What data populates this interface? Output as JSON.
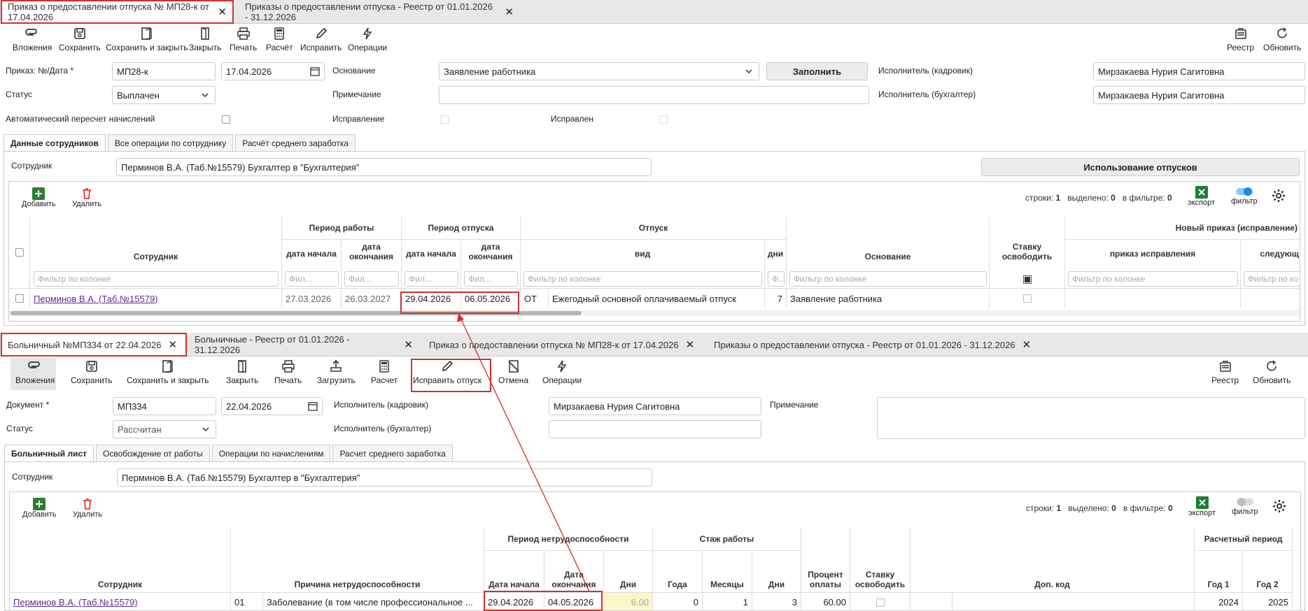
{
  "top": {
    "tabs": [
      {
        "label": "Приказ о предоставлении отпуска № МП28-к от 17.04.2026"
      },
      {
        "label": "Приказы о предоставлении отпуска - Реестр от 01.01.2026 - 31.12.2026"
      }
    ],
    "toolbar": {
      "attachments": "Вложения",
      "save": "Сохранить",
      "save_close": "Сохранить и закрыть",
      "close": "Закрыть",
      "print": "Печать",
      "calc": "Расчёт",
      "fix": "Исправить",
      "operations": "Операции",
      "registry": "Реестр",
      "refresh": "Обновить"
    },
    "form": {
      "order_label": "Приказ: №/Дата *",
      "order_no": "МП28-к",
      "order_date": "17.04.2026",
      "basis_label": "Основание",
      "basis_value": "Заявление работника",
      "fill_button": "Заполнить",
      "executor_hr_label": "Исполнитель (кадровик)",
      "executor_hr": "Мирзакаева Нурия Сагитовна",
      "status_label": "Статус",
      "status_value": "Выплачен",
      "note_label": "Примечание",
      "note_value": "",
      "executor_acc_label": "Исполнитель (бухгалтер)",
      "executor_acc": "Мирзакаева Нурия Сагитовна",
      "auto_recalc_label": "Автоматический пересчет начислений",
      "fix_label": "Исправление",
      "fixed_label": "Исправлен"
    },
    "subtabs": [
      "Данные сотрудников",
      "Все операции по сотруднику",
      "Расчёт среднего заработка"
    ],
    "employee_label": "Сотрудник",
    "employee_value": "Перминов В.А. (Таб.№15579) Бухгалтер в \"Бухгалтерия\"",
    "vacation_use_button": "Использование отпусков",
    "grid": {
      "add": "Добавить",
      "delete": "Удалить",
      "rows_label": "строки:",
      "rows": "1",
      "selected_label": "выделено:",
      "selected": "0",
      "filtered_label": "в фильтре:",
      "filtered": "0",
      "export": "экспорт",
      "filter": "фильтр",
      "h_employee": "Сотрудник",
      "h_work_period": "Период работы",
      "h_vac_period": "Период отпуска",
      "h_vacation": "Отпуск",
      "h_start": "дата начала",
      "h_end": "дата окончания",
      "h_type": "вид",
      "h_days": "дни",
      "h_basis": "Основание",
      "h_rate": "Ставку освободить",
      "h_new_order": "Новый приказ (исправление)",
      "h_fix_order": "приказ исправления",
      "h_next": "следующ",
      "filter_placeholder": "Фильтр по колонке",
      "filter_short": "Фил...",
      "filter_tiny": "Ф...",
      "filter_clip": "Фильтр по ко",
      "row": {
        "employee": "Перминов В.А. (Таб.№15579)",
        "work_start": "27.03.2026",
        "work_end": "26.03.2027",
        "vac_start": "29.04.2026",
        "vac_end": "06.05.2026",
        "code": "ОТ",
        "type": "Ежегодный основной оплачиваемый отпуск",
        "days": "7",
        "basis": "Заявление работника"
      }
    }
  },
  "bottom": {
    "tabs": [
      {
        "label": "Больничный №МП334 от 22.04.2026"
      },
      {
        "label": "Больничные - Реестр от 01.01.2026 - 31.12.2026"
      },
      {
        "label": "Приказ о предоставлении отпуска № МП28-к от 17.04.2026"
      },
      {
        "label": "Приказы о предоставлении отпуска - Реестр от 01.01.2026 - 31.12.2026"
      }
    ],
    "toolbar": {
      "attachments": "Вложения",
      "save": "Сохранить",
      "save_close": "Сохранить и закрыть",
      "close": "Закрыть",
      "print": "Печать",
      "load": "Загрузить",
      "calc": "Расчет",
      "fix_vacation": "Исправить отпуск",
      "cancel": "Отмена",
      "operations": "Операции",
      "registry": "Реестр",
      "refresh": "Обновить"
    },
    "form": {
      "doc_label": "Документ *",
      "doc_no": "МП334",
      "doc_date": "22.04.2026",
      "executor_hr_label": "Исполнитель (кадровик)",
      "executor_hr": "Мирзакаева Нурия Сагитовна",
      "note_label": "Примечание",
      "status_label": "Статус",
      "status_value": "Рассчитан",
      "executor_acc_label": "Исполнитель (бухгалтер)",
      "executor_acc": ""
    },
    "subtabs": [
      "Больничный лист",
      "Освобождение от работы",
      "Операции по начислениям",
      "Расчет среднего заработка"
    ],
    "employee_label": "Сотрудник",
    "employee_value": "Перминов В.А. (Таб.№15579) Бухгалтер в \"Бухгалтерия\"",
    "grid": {
      "add": "Добавить",
      "delete": "Удалить",
      "rows_label": "строки:",
      "rows": "1",
      "selected_label": "выделено:",
      "selected": "0",
      "filtered_label": "в фильтре:",
      "filtered": "0",
      "export": "экспорт",
      "filter": "фильтр",
      "h_employee": "Сотрудник",
      "h_reason": "Причина нетрудоспособности",
      "h_disability": "Период нетрудоспособности",
      "h_experience": "Стаж работы",
      "h_start": "Дата начала",
      "h_end": "Дата окончания",
      "h_days": "Дни",
      "h_years": "Года",
      "h_months": "Месяцы",
      "h_exp_days": "Дни",
      "h_pay_pct": "Процент оплаты",
      "h_rate": "Ставку освободить",
      "h_extra": "Доп. код",
      "h_calc_period": "Расчетный период",
      "h_year1": "Год 1",
      "h_year2": "Год 2",
      "row": {
        "employee": "Перминов В.А. (Таб.№15579)",
        "reason_code": "01",
        "reason": "Заболевание (в том числе профессиональное ...",
        "start": "29.04.2026",
        "end": "04.05.2026",
        "days": "6.00",
        "years": "0",
        "months": "1",
        "exp_days": "3",
        "pay_pct": "60.00",
        "year1": "2024",
        "year2": "2025"
      }
    }
  },
  "colors": {
    "accent_red": "#d32f2f",
    "export_green": "#1e7e34",
    "add_green": "#2e7d32",
    "delete_red": "#e53935",
    "toggle_blue": "#1e88e5"
  }
}
